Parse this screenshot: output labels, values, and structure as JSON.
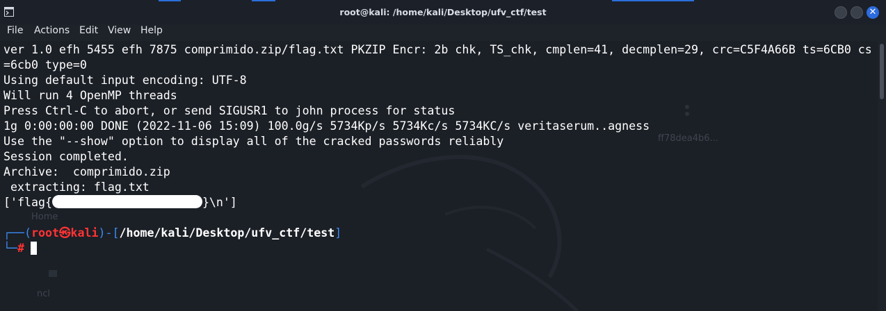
{
  "window": {
    "title": "root@kali: /home/kali/Desktop/ufv_ctf/test",
    "close_glyph": "✕"
  },
  "menu": [
    "File",
    "Actions",
    "Edit",
    "View",
    "Help"
  ],
  "desktop": {
    "ghost_home": "Home",
    "ghost_ncl": "ncl",
    "ghost_hash": "ff78dea4b6..."
  },
  "terminal": {
    "lines": [
      "ver 1.0 efh 5455 efh 7875 comprimido.zip/flag.txt PKZIP Encr: 2b chk, TS_chk, cmplen=41, decmplen=29, crc=C5F4A66B ts=6CB0 cs",
      "=6cb0 type=0",
      "Using default input encoding: UTF-8",
      "Will run 4 OpenMP threads",
      "Press Ctrl-C to abort, or send SIGUSR1 to john process for status",
      "1g 0:00:00:00 DONE (2022-11-06 15:09) 100.0g/s 5734Kp/s 5734Kc/s 5734KC/s veritaserum..agness",
      "Use the \"--show\" option to display all of the cracked passwords reliably",
      "Session completed.",
      "Archive:  comprimido.zip",
      " extracting: flag.txt"
    ],
    "flag_prefix": "['flag{",
    "flag_suffix": "}\\n']",
    "prompt": {
      "corner_top": "┌──(",
      "user": "root",
      "at": "㉿",
      "host": "kali",
      "sep": ")-[",
      "path": "/home/kali/Desktop/ufv_ctf/test",
      "close": "]",
      "corner_bottom": "└─",
      "symbol": "#"
    }
  },
  "colors": {
    "prompt_blue": "#3b8cf2",
    "prompt_red": "#ff3333",
    "close_button": "#2d6cdf"
  }
}
